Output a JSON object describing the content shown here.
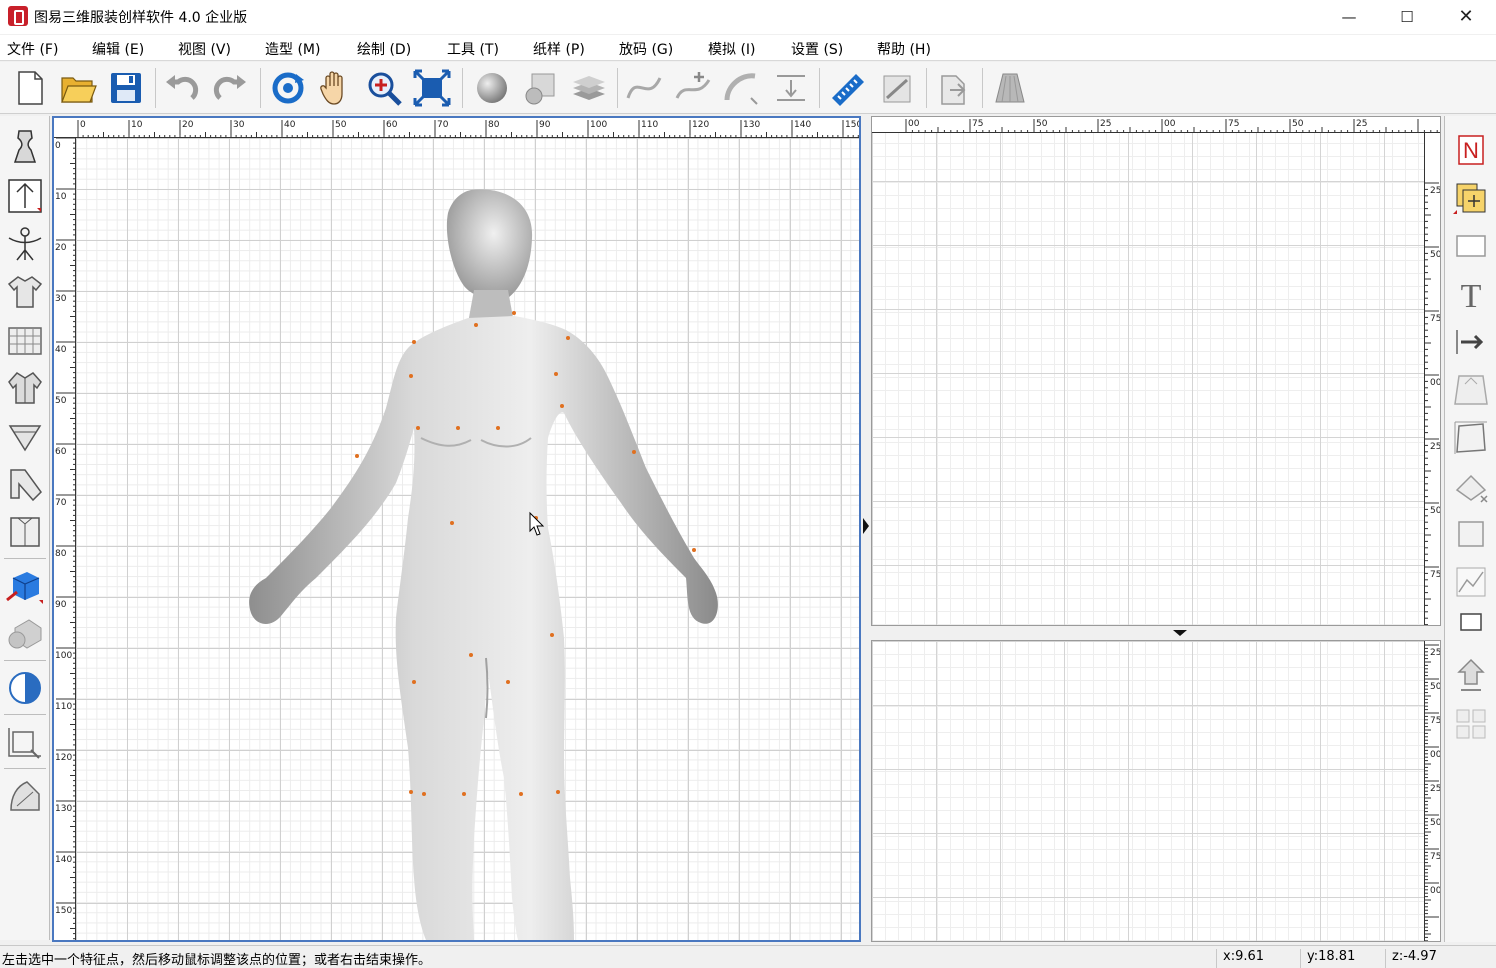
{
  "window": {
    "title": "图易三维服装创样软件 4.0 企业版",
    "minimize_symbol": "—",
    "maximize_symbol": "☐",
    "close_symbol": "✕"
  },
  "menu": [
    {
      "label": "文件 (F)"
    },
    {
      "label": "编辑 (E)"
    },
    {
      "label": "视图 (V)"
    },
    {
      "label": "造型 (M)"
    },
    {
      "label": "绘制 (D)"
    },
    {
      "label": "工具 (T)"
    },
    {
      "label": "纸样 (P)"
    },
    {
      "label": "放码 (G)"
    },
    {
      "label": "模拟 (I)"
    },
    {
      "label": "设置 (S)"
    },
    {
      "label": "帮助 (H)"
    }
  ],
  "toolbar": {
    "icons": [
      "new-file-icon",
      "open-folder-icon",
      "save-icon",
      "undo-icon",
      "redo-icon",
      "rotate-view-icon",
      "pan-hand-icon",
      "zoom-icon",
      "fit-view-icon",
      "shaded-sphere-icon",
      "material-icon",
      "layers-icon",
      "curve-icon",
      "add-point-curve-icon",
      "smooth-curve-icon",
      "align-icon",
      "measure-ruler-icon",
      "pattern-tool-icon",
      "export-icon",
      "skirt-icon"
    ]
  },
  "left_tools": {
    "icons": [
      "mannequin-icon",
      "measure-body-icon",
      "body-fit-icon",
      "shirt-icon",
      "fabric-grid-icon",
      "jacket-icon",
      "collar-icon",
      "sleeve-icon",
      "garment-pattern-icon",
      "cube-3d-icon",
      "lamp-render-icon",
      "hemisphere-icon",
      "transform-icon",
      "pattern-piece-icon"
    ]
  },
  "right_tools": {
    "icons": [
      "new-n-icon",
      "add-layer-icon",
      "rectangle-icon",
      "text-tool-icon",
      "arrow-right-icon",
      "sleeve-piece-icon",
      "frame-icon",
      "erase-shape-icon",
      "square-icon",
      "graph-icon",
      "stack-icon",
      "upload-icon",
      "grid-four-icon"
    ],
    "n_label": "N",
    "text_label": "T"
  },
  "ruler_main": {
    "x_labels": [
      "0",
      "10",
      "20",
      "30",
      "40",
      "50",
      "60",
      "70",
      "80",
      "90",
      "100",
      "110",
      "120",
      "130",
      "140",
      "150"
    ],
    "y_labels": [
      "0",
      "10",
      "20",
      "30",
      "40",
      "50",
      "60",
      "70",
      "80",
      "90",
      "100",
      "110",
      "120",
      "130",
      "140",
      "150"
    ]
  },
  "ruler_pattern": {
    "x_labels": [
      "00",
      "75",
      "50",
      "25",
      "00",
      "75",
      "50",
      "25"
    ],
    "y_labels": [
      "25",
      "50",
      "75",
      "00",
      "25",
      "50",
      "75"
    ]
  },
  "ruler_lower": {
    "y_labels": [
      "25",
      "50",
      "75",
      "00",
      "25",
      "50",
      "75",
      "00"
    ]
  },
  "status": {
    "message": "左击选中一个特征点，然后移动鼠标调整该点的位置；或者右击结束操作。",
    "x": "x:9.61",
    "y": "y:18.81",
    "z": "z:-4.97"
  }
}
